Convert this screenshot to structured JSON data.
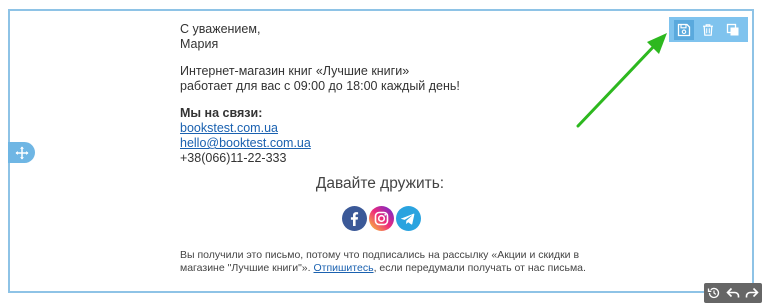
{
  "email": {
    "greeting": "С уважением,",
    "name": "Мария",
    "shop_line1": "Интернет-магазин книг «Лучшие книги»",
    "shop_line2": "работает для вас с 09:00 до 18:00 каждый день!",
    "contacts_title": "Мы на связи:",
    "site_link": "bookstest.com.ua ",
    "email_link": "hello@booktest.com.ua ",
    "phone": "+38(066)11-22-333",
    "friends_title": "Давайте дружить:",
    "footer_before": "Вы получили это письмо, потому что подписались на рассылку «Акции и скидки в магазине \"Лучшие книги\"». ",
    "unsubscribe_link": "Отпишитесь",
    "footer_after": ", если передумали получать от нас письма."
  },
  "social": [
    "facebook-icon",
    "instagram-icon",
    "telegram-icon"
  ],
  "toolbar": [
    "save-icon",
    "trash-icon",
    "duplicate-icon"
  ],
  "bottom_toolbar": [
    "history-icon",
    "undo-icon",
    "redo-icon"
  ],
  "colors": {
    "frame_border": "#8ec3e6",
    "toolbar_bg": "#7fc3ee",
    "link": "#1a61b0",
    "arrow": "#2db81f",
    "bottom_bar": "#666666"
  }
}
